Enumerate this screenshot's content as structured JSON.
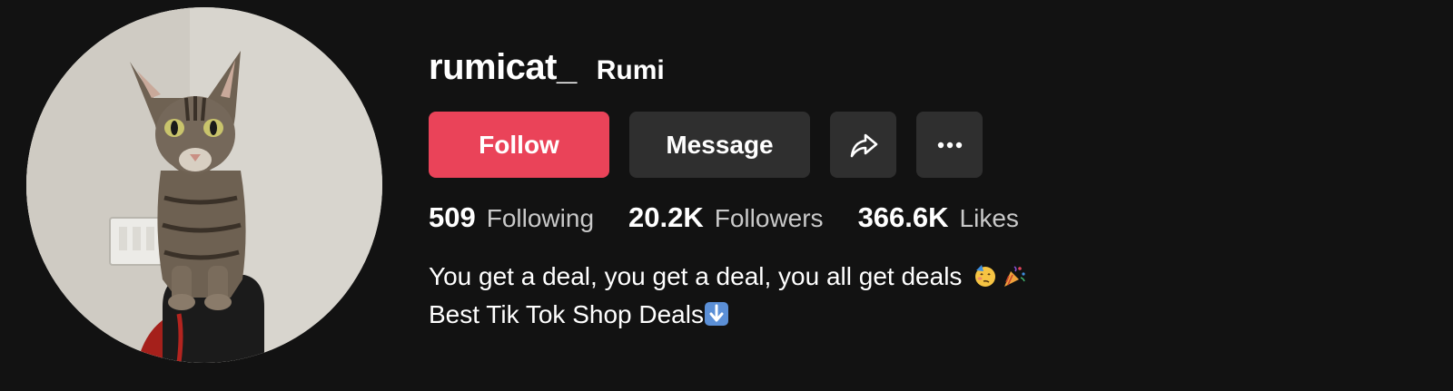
{
  "profile": {
    "username": "rumicat_",
    "display_name": "Rumi"
  },
  "actions": {
    "follow_label": "Follow",
    "message_label": "Message",
    "share_icon": "share-arrow-icon",
    "more_icon": "more-dots-icon"
  },
  "stats": {
    "following_count": "509",
    "following_label": "Following",
    "followers_count": "20.2K",
    "followers_label": "Followers",
    "likes_count": "366.6K",
    "likes_label": "Likes"
  },
  "bio": {
    "line1": "You get a deal, you get a deal, you all get deals",
    "line1_emojis": [
      "partying-face-emoji",
      "party-popper-emoji"
    ],
    "line2": "Best Tik Tok Shop Deals",
    "line2_emoji": "down-arrow-emoji"
  },
  "colors": {
    "background": "#121212",
    "follow_button": "#ea4359",
    "secondary_button": "#2f2f2f",
    "muted_text": "#c9c9c9"
  }
}
